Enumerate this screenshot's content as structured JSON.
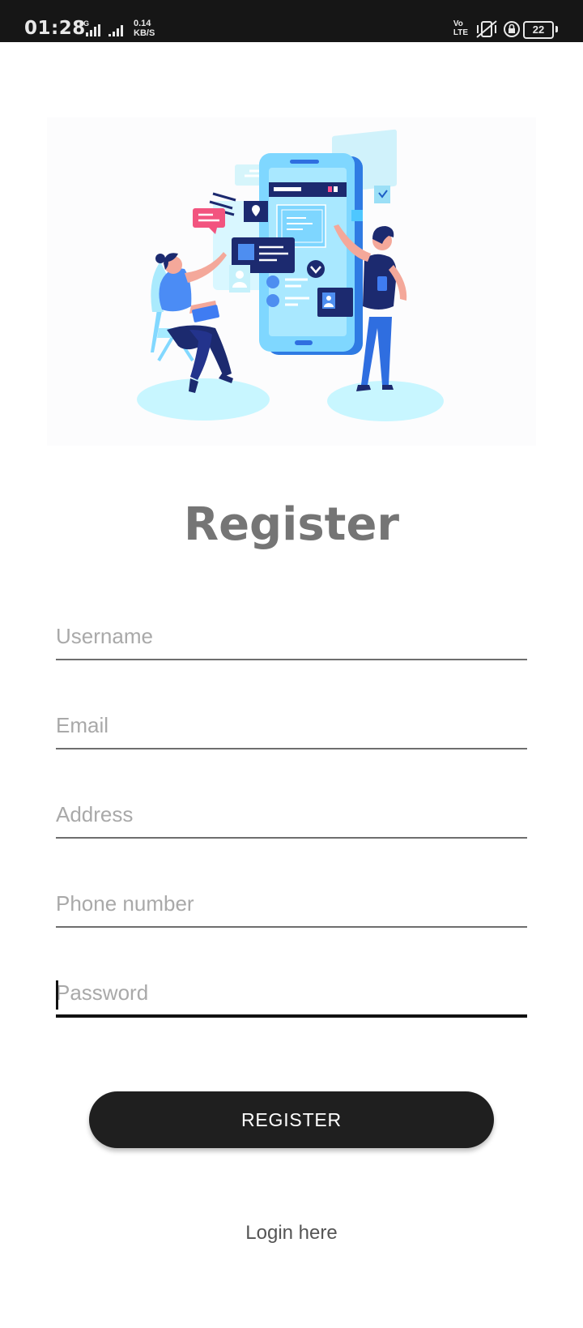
{
  "status_bar": {
    "time": "01:28",
    "network": "4G",
    "speed_value": "0.14",
    "speed_unit": "KB/S",
    "volte_top": "Vo",
    "volte_bottom": "LTE",
    "battery": "22"
  },
  "illustration": {
    "icon": "mobile-app-illustration"
  },
  "page": {
    "title": "Register"
  },
  "form": {
    "username_placeholder": "Username",
    "email_placeholder": "Email",
    "address_placeholder": "Address",
    "phone_placeholder": "Phone number",
    "password_placeholder": "Password",
    "register_label": "REGISTER",
    "login_link": "Login here"
  },
  "colors": {
    "button_bg": "#1f1f1f",
    "title": "#757575",
    "accent_blue": "#3f7cf2",
    "navy": "#1a237e",
    "light_cyan": "#a8f0ff"
  }
}
